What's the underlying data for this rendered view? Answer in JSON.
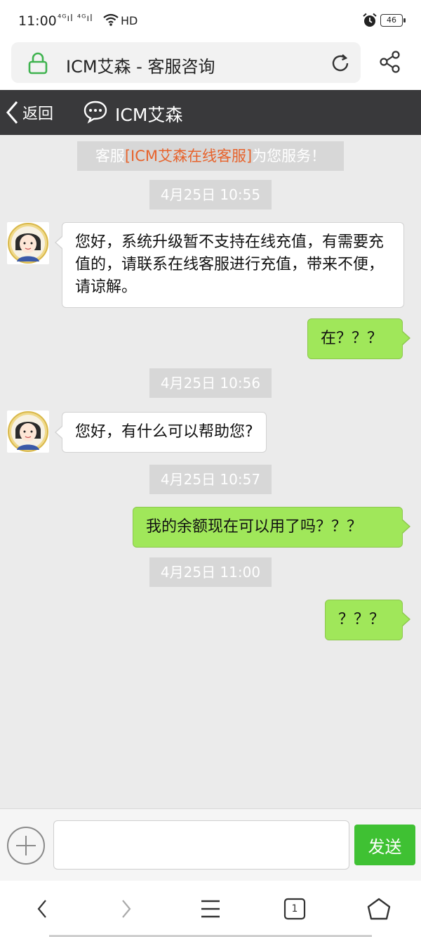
{
  "status_bar": {
    "time": "11:00",
    "signal": "⁴ᴳıl ⁴ᴳıl",
    "hd": "HD",
    "battery": "46"
  },
  "browser": {
    "page_title": "ICM艾森 - 客服咨询"
  },
  "chat_header": {
    "back_label": "返回",
    "title": "ICM艾森"
  },
  "notice": {
    "prefix": "客服",
    "highlight": "[ICM艾森在线客服]",
    "suffix": "为您服务！"
  },
  "messages": [
    {
      "kind": "timestamp",
      "text": "4月25日 10:55"
    },
    {
      "kind": "in",
      "text": "您好，系统升级暂不支持在线充值，有需要充值的，请联系在线客服进行充值，带来不便，请谅解。"
    },
    {
      "kind": "out",
      "text": "在？？？"
    },
    {
      "kind": "timestamp",
      "text": "4月25日 10:56"
    },
    {
      "kind": "in",
      "text": "您好，有什么可以帮助您?"
    },
    {
      "kind": "timestamp",
      "text": "4月25日 10:57"
    },
    {
      "kind": "out",
      "text": "我的余额现在可以用了吗？？？"
    },
    {
      "kind": "timestamp",
      "text": "4月25日 11:00"
    },
    {
      "kind": "out",
      "text": "？？？"
    }
  ],
  "input": {
    "value": "",
    "placeholder": "",
    "send_label": "发送"
  },
  "nav": {
    "tabs_count": "1"
  },
  "colors": {
    "header_bg": "#39393b",
    "outgoing_bubble": "#a0e75a",
    "send_button": "#3fc133",
    "notice_highlight": "#e7632c"
  }
}
